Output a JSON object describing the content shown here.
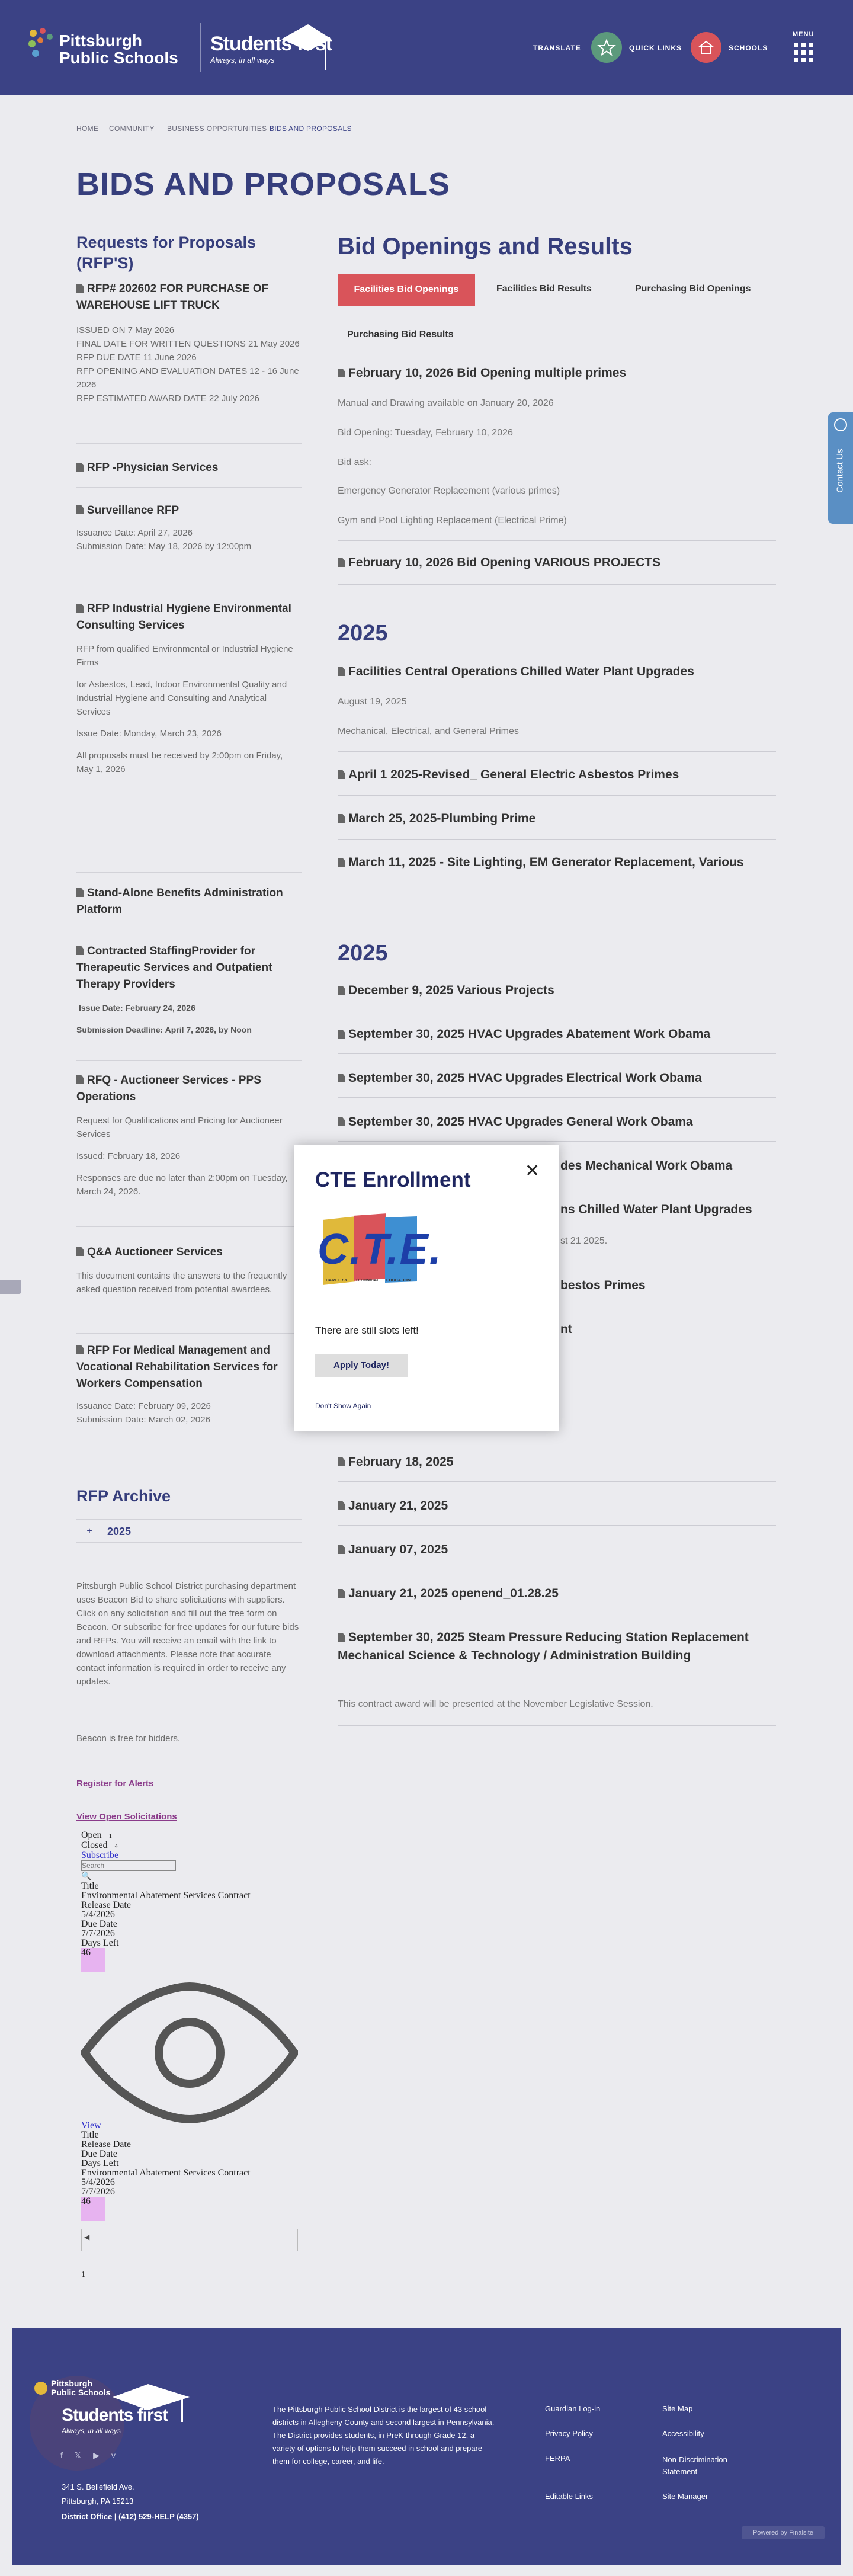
{
  "header": {
    "logo_line1": "Pittsburgh",
    "logo_line2": "Public Schools",
    "sf_title": "Students first",
    "sf_tag": "Always, in all ways",
    "translate": "TRANSLATE",
    "quick_links": "QUICK LINKS",
    "schools": "SCHOOLS",
    "menu": "MENU",
    "colors": {
      "brand": "#3b4285",
      "quick": "#5c9a7c",
      "schools": "#d9545a"
    }
  },
  "breadcrumb": {
    "home": "HOME",
    "community": "COMMUNITY",
    "business": "BUSINESS OPPORTUNITIES",
    "current": "BIDS AND PROPOSALS"
  },
  "page_title": "BIDS AND PROPOSALS",
  "left": {
    "heading": "Requests for Proposals (RFP'S)",
    "rfp1": {
      "title": "RFP# 202602 FOR PURCHASE OF WAREHOUSE LIFT TRUCK",
      "l1": "ISSUED ON 7 May 2026",
      "l2": "FINAL DATE FOR WRITTEN QUESTIONS 21 May 2026",
      "l3": "RFP DUE DATE 11 June 2026",
      "l4": "RFP OPENING AND EVALUATION DATES 12 - 16 June 2026",
      "l5": "RFP ESTIMATED AWARD DATE 22 July 2026"
    },
    "rfp2": {
      "title": "RFP -Physician Services"
    },
    "rfp3": {
      "title": "Surveillance RFP",
      "l1": "Issuance Date: April 27, 2026",
      "l2": "Submission Date: May 18, 2026 by 12:00pm"
    },
    "rfp4": {
      "title": "RFP Industrial Hygiene Environmental Consulting Services",
      "l1": "RFP from qualified Environmental or Industrial Hygiene Firms",
      "l2": "for Asbestos, Lead, Indoor Environmental Quality and Industrial Hygiene and Consulting and Analytical Services",
      "l3": "Issue Date: Monday, March 23, 2026",
      "l4": "All proposals must be received by 2:00pm on Friday, May 1, 2026"
    },
    "rfp5": {
      "title": "Stand-Alone Benefits Administration Platform"
    },
    "rfp6": {
      "title": "Contracted StaffingProvider for Therapeutic Services and Outpatient Therapy Providers",
      "l1": "Issue Date: February 24, 2026",
      "l2": "Submission Deadline: April 7, 2026, by Noon"
    },
    "rfp7": {
      "title": "RFQ - Auctioneer Services - PPS Operations",
      "l1": "Request for Qualifications and Pricing for Auctioneer Services",
      "l2": "Issued: February 18, 2026",
      "l3": "Responses are due no later than 2:00pm on Tuesday, March 24, 2026."
    },
    "rfp8": {
      "title": "Q&A Auctioneer Services",
      "l1": "This document contains the answers to the frequently asked question received from potential awardees."
    },
    "rfp9": {
      "title": "RFP For Medical Management and Vocational Rehabilitation Services for Workers Compensation",
      "l1": "Issuance Date: February 09, 2026",
      "l2": "Submission Date: March 02, 2026"
    },
    "archive": {
      "heading": "RFP Archive",
      "year": "2025"
    },
    "beacon_p1": "Pittsburgh Public School District purchasing department uses Beacon Bid to share solicitations with suppliers. Click on any solicitation and fill out the free form on Beacon. Or subscribe for free updates for our future bids and RFPs. You will receive an email with the link to download attachments. Please note that accurate contact information is required in order to receive any updates.",
    "beacon_p2": "Beacon is free for bidders.",
    "register": "Register for Alerts",
    "view_open": "View Open Solicitations",
    "widget": {
      "open": "Open",
      "open_count": "1",
      "closed": "Closed",
      "closed_count": "4",
      "subscribe": "Subscribe",
      "search_placeholder": "Search",
      "title_h": "Title",
      "title": "Environmental Abatement Services Contract",
      "release_h": "Release Date",
      "release": "5/4/2026",
      "due_h": "Due Date",
      "due": "7/7/2026",
      "days_h": "Days Left",
      "days": "46",
      "view": "View",
      "page": "1"
    }
  },
  "right": {
    "heading": "Bid Openings and Results",
    "tabs": [
      "Facilities Bid Openings",
      "Facilities Bid Results",
      "Purchasing Bid Openings",
      "Purchasing Bid Results"
    ],
    "b1": {
      "title": "February 10, 2026 Bid Opening multiple primes",
      "l1": "Manual and Drawing available on January 20, 2026",
      "l2": "Bid Opening: Tuesday, February 10, 2026",
      "l3": "Bid ask:",
      "l4": "Emergency Generator Replacement (various primes)",
      "l5": "Gym and Pool Lighting Replacement (Electrical Prime)"
    },
    "b2": "February 10, 2026 Bid Opening VARIOUS PROJECTS",
    "year1": "2025",
    "b3": {
      "title": "Facilities Central Operations Chilled Water Plant Upgrades",
      "l1": "August 19, 2025",
      "l2": "Mechanical, Electrical, and General Primes"
    },
    "b4": "April 1 2025-Revised_ General Electric Asbestos Primes",
    "b5": "March 25, 2025-Plumbing Prime",
    "b6": "March 11, 2025 - Site Lighting, EM Generator Replacement, Various",
    "year2": "2025",
    "r1": "December 9, 2025 Various Projects",
    "r2": "September 30, 2025 HVAC Upgrades Abatement Work Obama",
    "r3": "September 30, 2025 HVAC Upgrades Electrical Work Obama",
    "r4": "September 30, 2025 HVAC Upgrades General Work Obama",
    "r5": "des Mechanical Work Obama",
    "r6": "ns Chilled Water Plant Upgrades",
    "r6b": "st 21 2025.",
    "r7": "bestos Primes",
    "r8": "nt",
    "r9": "February 18, 2025",
    "r10": "January 21, 2025",
    "r11": "January 07, 2025",
    "r12": "January 21, 2025 openend_01.28.25",
    "r13": {
      "title": "September 30, 2025 Steam Pressure Reducing Station Replacement Mechanical Science & Technology / Administration Building",
      "l1": "This contract award will be presented at the November Legislative Session."
    }
  },
  "side_tab": "Contact Us",
  "modal": {
    "title": "CTE Enrollment",
    "body": "There are still slots left!",
    "apply": "Apply Today!",
    "dont_show": "Don't Show Again",
    "logo_text": "C.T.E.",
    "logo_sub1": "CAREER &",
    "logo_sub2": "TECHNICAL",
    "logo_sub3": "EDUCATION"
  },
  "footer": {
    "logo1": "Pittsburgh",
    "logo2": "Public Schools",
    "sf_title": "Students first",
    "sf_tag": "Always, in all ways",
    "address1": "341 S. Bellefield Ave.",
    "address2": "Pittsburgh, PA  15213",
    "office": "District Office | (412) 529-HELP (4357)",
    "about": "The Pittsburgh Public School District is the largest of 43 school districts in Allegheny County and second largest in Pennsylvania. The District provides students, in PreK through Grade 12, a variety of options to help them succeed in school and prepare them for college, career, and life.",
    "links_col1": [
      "Guardian Log-in",
      "Privacy Policy",
      "FERPA",
      "Editable Links"
    ],
    "links_col2": [
      "Site Map",
      "Accessibility",
      "Non-Discrimination Statement",
      "Site Manager"
    ],
    "powered": "Powered by Finalsite"
  }
}
